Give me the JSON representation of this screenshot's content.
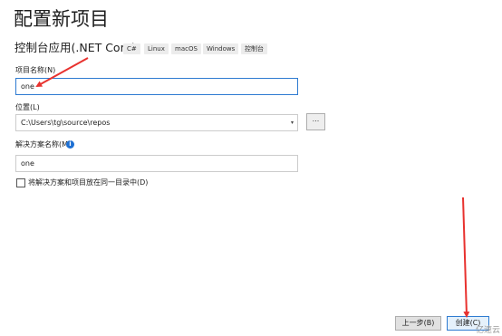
{
  "header": {
    "title": "配置新项目",
    "subtitle": "控制台应用(.NET Core)",
    "tags": [
      "C#",
      "Linux",
      "macOS",
      "Windows",
      "控制台"
    ]
  },
  "form": {
    "project_name_label": "项目名称(N)",
    "project_name_value": "one",
    "location_label": "位置(L)",
    "location_value": "C:\\Users\\tg\\source\\repos",
    "browse_label": "...",
    "solution_name_label": "解决方案名称(M)",
    "solution_name_value": "one",
    "same_dir_label": "将解决方案和项目放在同一目录中(D)",
    "same_dir_checked": false
  },
  "footer": {
    "back_label": "上一步(B)",
    "create_label": "创建(C)"
  },
  "watermark": "亿速云",
  "colors": {
    "accent": "#2e7bd1",
    "annotation_arrow": "#e8322f",
    "info_icon": "#1c6fd3"
  },
  "icons": [
    "dropdown-caret-icon",
    "info-icon",
    "annotation-arrow"
  ]
}
